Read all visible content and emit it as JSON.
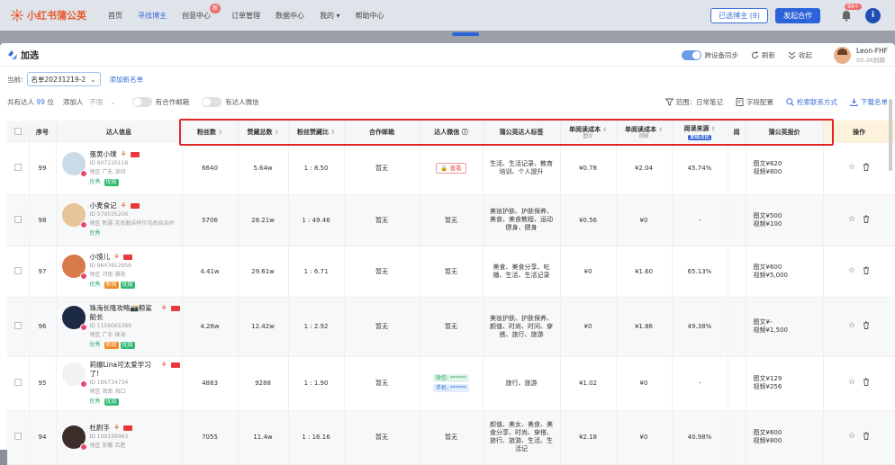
{
  "topbar": {
    "logo": "小红书蒲公英",
    "nav": [
      {
        "label": "首页",
        "active": false
      },
      {
        "label": "寻找博主",
        "active": true
      },
      {
        "label": "创意中心",
        "active": false,
        "badge": "新"
      },
      {
        "label": "订单管理",
        "active": false
      },
      {
        "label": "数据中心",
        "active": false
      },
      {
        "label": "我的 ▾",
        "active": false
      },
      {
        "label": "帮助中心",
        "active": false
      }
    ],
    "selected_btn": "已选博主 (9)",
    "coop_btn": "发起合作",
    "bell_badge": "99+",
    "avatar_letter": "i"
  },
  "panel": {
    "title": "加选",
    "sync_label": "跨设备同步",
    "refresh_label": "刷新",
    "collapse_label": "收起",
    "user_name": "Leon-FHF",
    "user_date": "05-26到期"
  },
  "filters": {
    "current_label": "当前:",
    "list_name": "名单20231219-2",
    "new_list": "添加新名单",
    "total_prefix": "共有达人",
    "total_count": "99",
    "total_suffix": "位",
    "add_label": "添加人",
    "add_value": "不限",
    "has_email": "有合作邮箱",
    "has_wechat": "有达人微信",
    "scope_label": "范围：日常笔记",
    "field_config": "字段配置",
    "contact_search": "检索联系方式",
    "download": "下载名单"
  },
  "table": {
    "headers": [
      {
        "label": ""
      },
      {
        "label": "序号"
      },
      {
        "label": "达人信息"
      },
      {
        "label": "粉丝数",
        "sort": "⇕"
      },
      {
        "label": "赞藏总数",
        "sort": "⇕"
      },
      {
        "label": "粉丝赞藏比",
        "sort": "⇕"
      },
      {
        "label": "合作邮箱"
      },
      {
        "label": "达人微信 ⓘ"
      },
      {
        "label": "蒲公英达人标签"
      },
      {
        "label": "单阅读成本",
        "sub": "图文",
        "sort": "⇕"
      },
      {
        "label": "单阅读成本",
        "sub": "视频",
        "sort": "⇕"
      },
      {
        "label": "阅读来源",
        "tag": "发现占比",
        "sort": "⇕"
      },
      {
        "label": "阅"
      },
      {
        "label": "蒲公英报价"
      },
      {
        "label": "操作"
      }
    ],
    "rows": [
      {
        "idx": "99",
        "name": "蛋黄小璞",
        "id": "ID 607220118",
        "region": "地区 广东 深圳",
        "quality": "优秀",
        "tags": [
          {
            "t": "优效",
            "c": "g"
          }
        ],
        "fans": "6640",
        "likes": "5.64w",
        "ratio": "1 : 8.50",
        "email": "暂无",
        "wechat_view": "查看",
        "label": "生活、生活记录、教育培训、个人提升",
        "cpr_img": "¥0.78",
        "cpr_vid": "¥2.04",
        "source": "45.74%",
        "quote1": "图文¥620",
        "quote2": "视频¥800",
        "ava": "#c9dbe9"
      },
      {
        "idx": "98",
        "name": "小麦食记",
        "id": "ID 570035206",
        "region": "地区 新疆 克孜勒苏柯尔克孜自治州",
        "quality": "优秀",
        "tags": [],
        "fans": "5706",
        "likes": "28.21w",
        "ratio": "1 : 49.46",
        "email": "暂无",
        "wechat": "暂无",
        "label": "美妆护肤、护肤保养、美食、美食教程、运动健身、健身",
        "cpr_img": "¥0.56",
        "cpr_vid": "¥0",
        "source": "-",
        "quote1": "图文¥500",
        "quote2": "视频¥100",
        "ava": "#e8c49a"
      },
      {
        "idx": "97",
        "name": "小馍儿",
        "id": "ID 9643922956",
        "region": "地区 河南 濮阳",
        "quality": "优秀",
        "tags": [
          {
            "t": "新锐",
            "c": "o"
          },
          {
            "t": "优效",
            "c": "g"
          }
        ],
        "fans": "4.41w",
        "likes": "29.61w",
        "ratio": "1 : 6.71",
        "email": "暂无",
        "wechat": "暂无",
        "label": "美食、美食分享、吃播、生活、生活记录",
        "cpr_img": "¥0",
        "cpr_vid": "¥1.60",
        "source": "65.13%",
        "quote1": "图文¥600",
        "quote2": "视频¥5,000",
        "ava": "#d97a4a"
      },
      {
        "idx": "96",
        "name": "珠海长隆攻略📸鲸鲨船长",
        "id": "ID 1156065369",
        "region": "地区 广东 珠海",
        "quality": "优秀",
        "tags": [
          {
            "t": "新锐",
            "c": "o"
          },
          {
            "t": "优效",
            "c": "g"
          }
        ],
        "fans": "4.26w",
        "likes": "12.42w",
        "ratio": "1 : 2.92",
        "email": "暂无",
        "wechat": "暂无",
        "label": "美妆护肤、护肤保养、颜值、时尚、时间、穿搭、旅行、旅游",
        "cpr_img": "¥0",
        "cpr_vid": "¥1.86",
        "source": "49.38%",
        "quote1": "图文¥-",
        "quote2": "视频¥1,500",
        "ava": "#1d2a44"
      },
      {
        "idx": "95",
        "name": "莉娜Lina可太爱学习了!",
        "id": "ID 186734734",
        "region": "地区 海南 海口",
        "quality": "优秀",
        "tags": [
          {
            "t": "优效",
            "c": "g"
          }
        ],
        "fans": "4883",
        "likes": "9288",
        "ratio": "1 : 1.90",
        "email": "暂无",
        "wechat_lines": [
          "微信: ******",
          "手机: ******"
        ],
        "label": "旅行、旅游",
        "cpr_img": "¥1.02",
        "cpr_vid": "¥0",
        "source": "-",
        "quote1": "图文¥129",
        "quote2": "视频¥256",
        "ava": "#f2f2f2"
      },
      {
        "idx": "94",
        "name": "杜尉手",
        "id": "ID 109199963",
        "region": "地区 安徽 合肥",
        "quality": "",
        "tags": [],
        "fans": "7055",
        "likes": "11.4w",
        "ratio": "1 : 16.16",
        "email": "暂无",
        "wechat": "暂无",
        "label": "颜值、美女、美食、美食分享、时尚、穿搭、旅行、旅游、生活、生活记",
        "cpr_img": "¥2.18",
        "cpr_vid": "¥0",
        "source": "40.98%",
        "quote1": "图文¥600",
        "quote2": "视频¥800",
        "ava": "#3b2e2a"
      }
    ]
  },
  "colors": {
    "accent": "#2d63d8",
    "highlight": "#e02626",
    "brand": "#e8582b"
  }
}
